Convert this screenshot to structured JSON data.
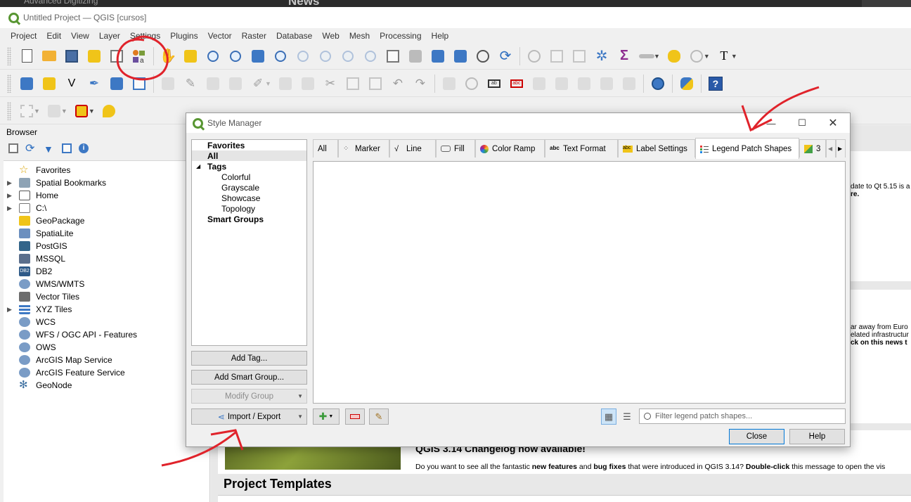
{
  "background_window": {
    "top_strip_left": "Advanced Digitizing",
    "top_strip_news": "News"
  },
  "window": {
    "title": "Untitled Project — QGIS [cursos]"
  },
  "menu": [
    "Project",
    "Edit",
    "View",
    "Layer",
    "Settings",
    "Plugins",
    "Vector",
    "Raster",
    "Database",
    "Web",
    "Mesh",
    "Processing",
    "Help"
  ],
  "browser": {
    "title": "Browser",
    "items": [
      {
        "label": "Favorites",
        "icon": "star-icon",
        "expandable": false
      },
      {
        "label": "Spatial Bookmarks",
        "icon": "bookmark-icon",
        "expandable": true
      },
      {
        "label": "Home",
        "icon": "home-icon",
        "expandable": true
      },
      {
        "label": "C:\\",
        "icon": "folder-icon",
        "expandable": true
      },
      {
        "label": "GeoPackage",
        "icon": "geopackage-icon",
        "expandable": false
      },
      {
        "label": "SpatiaLite",
        "icon": "spatialite-icon",
        "expandable": false
      },
      {
        "label": "PostGIS",
        "icon": "postgis-icon",
        "expandable": false
      },
      {
        "label": "MSSQL",
        "icon": "mssql-icon",
        "expandable": false
      },
      {
        "label": "DB2",
        "icon": "db2-icon",
        "expandable": false
      },
      {
        "label": "WMS/WMTS",
        "icon": "globe-icon",
        "expandable": false
      },
      {
        "label": "Vector Tiles",
        "icon": "vector-tiles-icon",
        "expandable": false
      },
      {
        "label": "XYZ Tiles",
        "icon": "grid-icon",
        "expandable": true
      },
      {
        "label": "WCS",
        "icon": "globe-icon",
        "expandable": false
      },
      {
        "label": "WFS / OGC API - Features",
        "icon": "globe-icon",
        "expandable": false
      },
      {
        "label": "OWS",
        "icon": "globe-icon",
        "expandable": false
      },
      {
        "label": "ArcGIS Map Service",
        "icon": "globe-icon",
        "expandable": false
      },
      {
        "label": "ArcGIS Feature Service",
        "icon": "globe-icon",
        "expandable": false
      },
      {
        "label": "GeoNode",
        "icon": "geonode-icon",
        "expandable": false
      }
    ]
  },
  "news": {
    "card1_line1": "date to Qt 5.15 is a",
    "card1_line2": "re.",
    "card2_line1": "ar away from Euro",
    "card2_line2": "elated infrastructur",
    "card2_line3": "ck on this news t",
    "changelog_title": "QGIS 3.14 Changelog now available!",
    "changelog_text_pre": "Do you want to see all the fantastic ",
    "changelog_text_b1": "new features",
    "changelog_text_mid": " and ",
    "changelog_text_b2": "bug fixes",
    "changelog_text_post": " that were introduced in QGIS 3.14? ",
    "changelog_text_b3": "Double-click",
    "changelog_text_end": " this message to open the vis",
    "project_templates": "Project Templates"
  },
  "style_manager": {
    "title": "Style Manager",
    "tree": {
      "favorites": "Favorites",
      "all": "All",
      "tags": "Tags",
      "tag_items": [
        "Colorful",
        "Grayscale",
        "Showcase",
        "Topology"
      ],
      "smart_groups": "Smart Groups"
    },
    "buttons": {
      "add_tag": "Add Tag...",
      "add_smart_group": "Add Smart Group...",
      "modify_group": "Modify Group",
      "import_export": "Import / Export",
      "close": "Close",
      "help": "Help"
    },
    "tabs": [
      {
        "label": "All",
        "icon": ""
      },
      {
        "label": "Marker",
        "icon": "marker-icon"
      },
      {
        "label": "Line",
        "icon": "line-icon"
      },
      {
        "label": "Fill",
        "icon": "fill-icon"
      },
      {
        "label": "Color Ramp",
        "icon": "color-ramp-icon"
      },
      {
        "label": "Text Format",
        "icon": "text-format-icon"
      },
      {
        "label": "Label Settings",
        "icon": "label-settings-icon"
      },
      {
        "label": "Legend Patch Shapes",
        "icon": "legend-patch-icon"
      },
      {
        "label": "3",
        "icon": "3d-icon"
      }
    ],
    "active_tab": "Legend Patch Shapes",
    "filter_placeholder": "Filter legend patch shapes..."
  },
  "colors": {
    "qgis_green": "#589632",
    "annotation_red": "#e0232b",
    "focus_blue": "#0078d7"
  }
}
